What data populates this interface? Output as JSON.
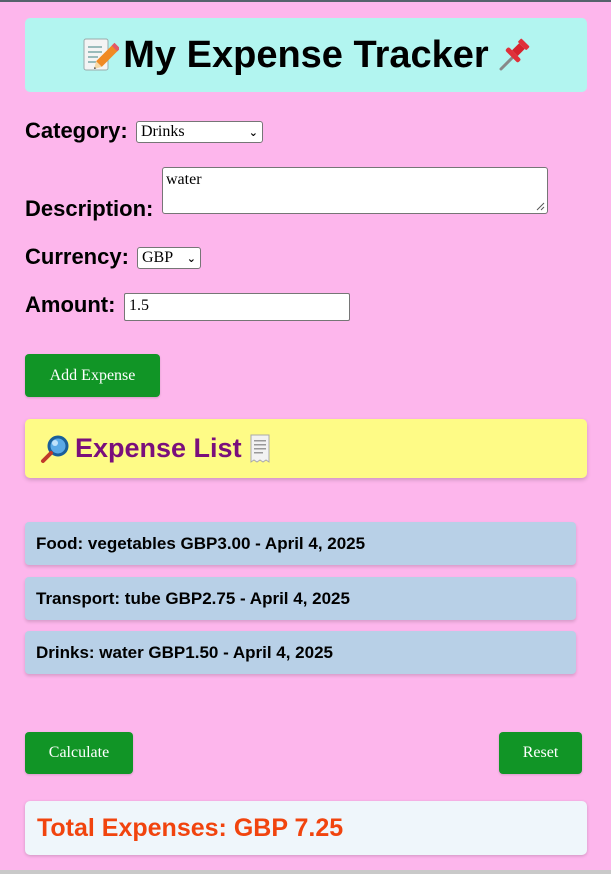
{
  "header": {
    "title": "My Expense Tracker",
    "left_icon": "memo-pencil-icon",
    "right_icon": "pushpin-icon"
  },
  "form": {
    "category_label": "Category:",
    "category_value": "Drinks",
    "description_label": "Description:",
    "description_value": "water",
    "currency_label": "Currency:",
    "currency_value": "GBP",
    "amount_label": "Amount:",
    "amount_value": "1.5",
    "add_button": "Add Expense"
  },
  "list": {
    "title": "Expense List",
    "left_icon": "magnifier-icon",
    "right_icon": "receipt-icon",
    "items": [
      "Food: vegetables GBP3.00 - April 4, 2025",
      "Transport: tube GBP2.75 - April 4, 2025",
      "Drinks: water GBP1.50 - April 4, 2025"
    ]
  },
  "actions": {
    "calculate": "Calculate",
    "reset": "Reset"
  },
  "total": {
    "text": "Total Expenses: GBP 7.25"
  },
  "colors": {
    "background": "#fdb6ec",
    "header_bg": "#b2f5f0",
    "button": "#119526",
    "list_header_bg": "#fefb86",
    "list_title": "#7a0f7c",
    "item_bg": "#b8d0e7",
    "total_text": "#f1440e"
  }
}
